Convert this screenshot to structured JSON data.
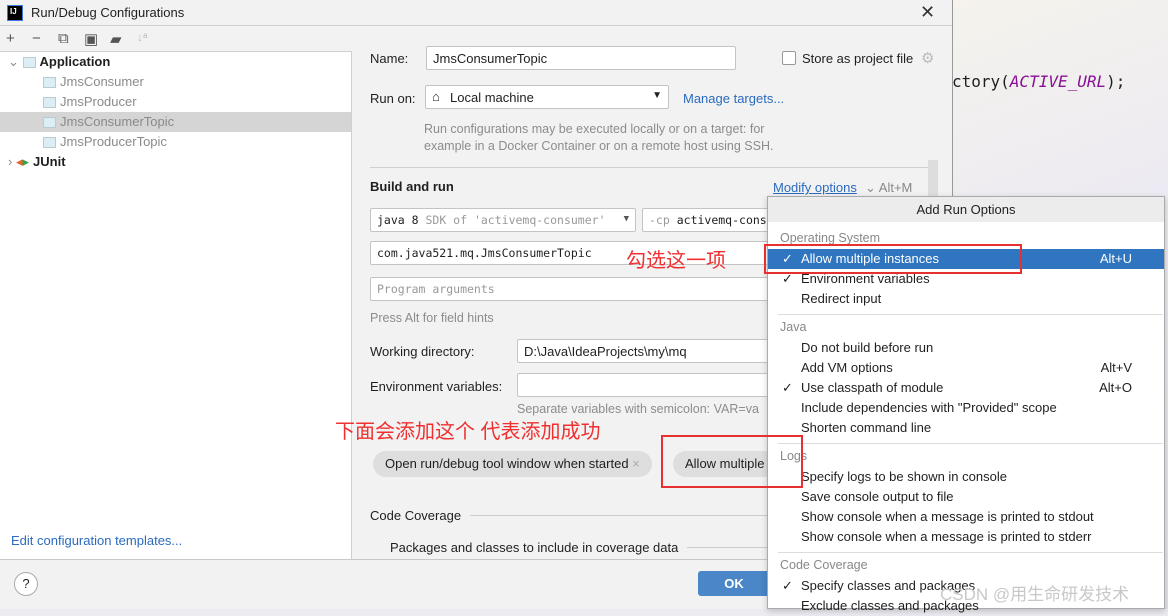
{
  "editor": {
    "code_prefix": "ctory(",
    "code_const": "ACTIVE_URL",
    "code_suffix": ");"
  },
  "window": {
    "title": "Run/Debug Configurations",
    "logo": "IJ",
    "close_icon": "close-icon"
  },
  "toolbar": {
    "icons": [
      "plus-icon",
      "minus-icon",
      "copy-icon",
      "save-icon",
      "folder-add-icon",
      "sort-icon"
    ]
  },
  "tree": {
    "application": "Application",
    "items": [
      "JmsConsumer",
      "JmsProducer",
      "JmsConsumerTopic",
      "JmsProducerTopic"
    ],
    "selected": "JmsConsumerTopic",
    "junit": "JUnit"
  },
  "left_footer": {
    "edit_templates": "Edit configuration templates..."
  },
  "form": {
    "name_label": "Name:",
    "name_value": "JmsConsumerTopic",
    "store_label": "Store as project file",
    "store_checked": false,
    "run_on_label": "Run on:",
    "run_on_value": "Local machine",
    "manage_targets": "Manage targets...",
    "run_on_hint_1": "Run configurations may be executed locally or on a target: for",
    "run_on_hint_2": "example in a Docker Container or on a remote host using SSH.",
    "build_run": "Build and run",
    "modify_options": "Modify options",
    "modify_shortcut": "Alt+M",
    "sdk_main": "java 8",
    "sdk_detail": "SDK of 'activemq-consumer'",
    "cp_prefix": "-cp",
    "cp_value": "activemq-cons",
    "main_class": "com.java521.mq.JmsConsumerTopic",
    "program_args_placeholder": "Program arguments",
    "field_hints": "Press Alt for field hints",
    "working_dir_label": "Working directory:",
    "working_dir_value": "D:\\Java\\IdeaProjects\\my\\mq",
    "env_label": "Environment variables:",
    "env_value": "",
    "env_hint": "Separate variables with semicolon: VAR=va",
    "chips": [
      "Open run/debug tool window when started",
      "Allow multiple"
    ],
    "code_coverage": "Code Coverage",
    "coverage_packages": "Packages and classes to include in coverage data"
  },
  "annotations": {
    "check_this": "勾选这一项",
    "added_success": "下面会添加这个 代表添加成功"
  },
  "bottom": {
    "help": "?",
    "ok": "OK"
  },
  "popup": {
    "title": "Add Run Options",
    "groups": [
      {
        "name": "Operating System",
        "items": [
          {
            "label": "Allow multiple instances",
            "checked": true,
            "shortcut": "Alt+U",
            "highlighted": true
          },
          {
            "label": "Environment variables",
            "checked": true,
            "shortcut": ""
          },
          {
            "label": "Redirect input",
            "checked": false,
            "shortcut": ""
          }
        ]
      },
      {
        "name": "Java",
        "items": [
          {
            "label": "Do not build before run",
            "checked": false,
            "shortcut": ""
          },
          {
            "label": "Add VM options",
            "checked": false,
            "shortcut": "Alt+V"
          },
          {
            "label": "Use classpath of module",
            "checked": true,
            "shortcut": "Alt+O"
          },
          {
            "label": "Include dependencies with \"Provided\" scope",
            "checked": false,
            "shortcut": ""
          },
          {
            "label": "Shorten command line",
            "checked": false,
            "shortcut": ""
          }
        ]
      },
      {
        "name": "Logs",
        "items": [
          {
            "label": "Specify logs to be shown in console",
            "checked": false,
            "shortcut": ""
          },
          {
            "label": "Save console output to file",
            "checked": false,
            "shortcut": ""
          },
          {
            "label": "Show console when a message is printed to stdout",
            "checked": false,
            "shortcut": ""
          },
          {
            "label": "Show console when a message is printed to stderr",
            "checked": false,
            "shortcut": ""
          }
        ]
      },
      {
        "name": "Code Coverage",
        "items": [
          {
            "label": "Specify classes and packages",
            "checked": true,
            "shortcut": ""
          },
          {
            "label": "Exclude classes and packages",
            "checked": false,
            "shortcut": ""
          }
        ]
      }
    ]
  },
  "watermark": "CSDN @用生命研发技术",
  "colors": {
    "accent": "#2f75c0",
    "annotation": "#e83030",
    "link": "#2a6bbf"
  }
}
